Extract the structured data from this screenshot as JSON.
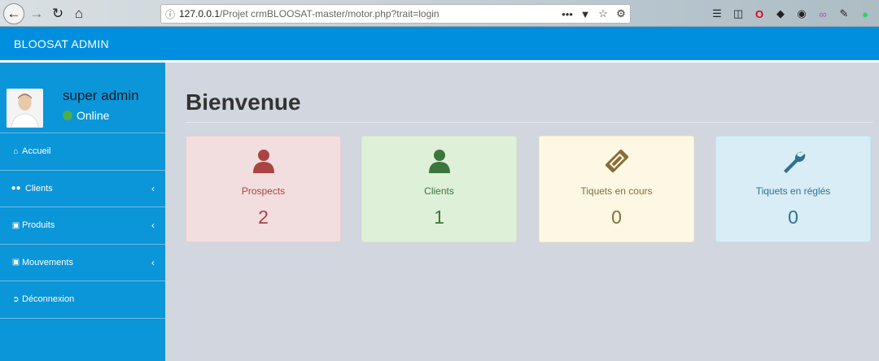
{
  "browser": {
    "url_host": "127.0.0.1",
    "url_path": "/Projet crmBLOOSAT-master/motor.php?trait=login",
    "icons": [
      "back-icon",
      "forward-icon",
      "reload-icon",
      "home-icon",
      "info-icon",
      "more-icon",
      "pocket-icon",
      "star-icon",
      "extension-icon",
      "library-icon",
      "sidebar-icon",
      "opera-icon",
      "location-icon",
      "vpn-icon",
      "ext-icon",
      "pen-icon",
      "whatsapp-icon"
    ]
  },
  "header": {
    "brand": "BLOOSAT ADMIN"
  },
  "user": {
    "name": "super admin",
    "status": "Online"
  },
  "menu": [
    {
      "label": "Accueil",
      "icon": "home-icon",
      "has_submenu": false
    },
    {
      "label": "Clients",
      "icon": "users-icon",
      "has_submenu": true
    },
    {
      "label": "Produits",
      "icon": "gift-icon",
      "has_submenu": true
    },
    {
      "label": "Mouvements",
      "icon": "gift-icon",
      "has_submenu": true
    },
    {
      "label": "Déconnexion",
      "icon": "sign-out-icon",
      "has_submenu": false
    }
  ],
  "page": {
    "title": "Bienvenue"
  },
  "cards": [
    {
      "label": "Prospects",
      "value": "2",
      "icon": "user-icon",
      "color": "#a94442"
    },
    {
      "label": "Clients",
      "value": "1",
      "icon": "user-icon",
      "color": "#3c763d"
    },
    {
      "label": "Tiquets en cours",
      "value": "0",
      "icon": "ticket-icon",
      "color": "#8a6d3b"
    },
    {
      "label": "Tiquets en réglés",
      "value": "0",
      "icon": "wrench-icon",
      "color": "#31708f"
    }
  ]
}
